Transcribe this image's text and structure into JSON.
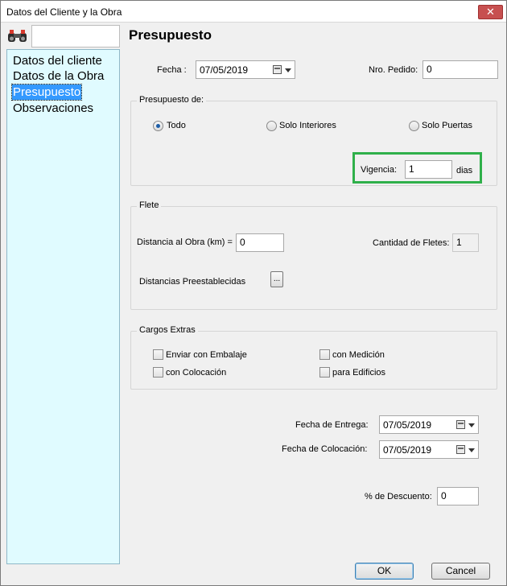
{
  "window": {
    "title": "Datos del Cliente y la Obra",
    "close_label": "✕"
  },
  "sidebar": {
    "search": {
      "value": "",
      "placeholder": ""
    },
    "items": [
      {
        "label": "Datos del cliente"
      },
      {
        "label": "Datos de la Obra"
      },
      {
        "label": "Presupuesto",
        "selected": true
      },
      {
        "label": "Observaciones"
      }
    ]
  },
  "main": {
    "title": "Presupuesto",
    "fecha": {
      "label": "Fecha :",
      "value": "07/05/2019"
    },
    "nro_pedido": {
      "label": "Nro. Pedido:",
      "value": "0"
    },
    "presupuesto_de": {
      "legend": "Presupuesto de:",
      "options": [
        {
          "label": "Todo",
          "checked": true
        },
        {
          "label": "Solo Interiores",
          "checked": false
        },
        {
          "label": "Solo Puertas",
          "checked": false
        }
      ],
      "vigencia": {
        "label": "Vigencia:",
        "value": "1",
        "unit": "dias"
      }
    },
    "flete": {
      "legend": "Flete",
      "distancia": {
        "label": "Distancia al Obra (km) =",
        "value": "0"
      },
      "cantidad": {
        "label": "Cantidad de Fletes:",
        "value": "1"
      },
      "preestablecidas": {
        "label": "Distancias Preestablecidas",
        "button_label": "..."
      }
    },
    "cargos_extras": {
      "legend": "Cargos Extras",
      "options": [
        {
          "label": "Enviar con Embalaje",
          "checked": false
        },
        {
          "label": "con Medición",
          "checked": false
        },
        {
          "label": "con Colocación",
          "checked": false
        },
        {
          "label": "para Edificios",
          "checked": false
        }
      ]
    },
    "fecha_entrega": {
      "label": "Fecha de Entrega:",
      "value": "07/05/2019"
    },
    "fecha_colocacion": {
      "label": "Fecha de Colocación:",
      "value": "07/05/2019"
    },
    "descuento": {
      "label": "% de Descuento:",
      "value": "0"
    }
  },
  "footer": {
    "ok_label": "OK",
    "cancel_label": "Cancel"
  },
  "colors": {
    "highlight": "#2fb04a",
    "tree_bg": "#e0fbff",
    "selection": "#3399ff"
  }
}
